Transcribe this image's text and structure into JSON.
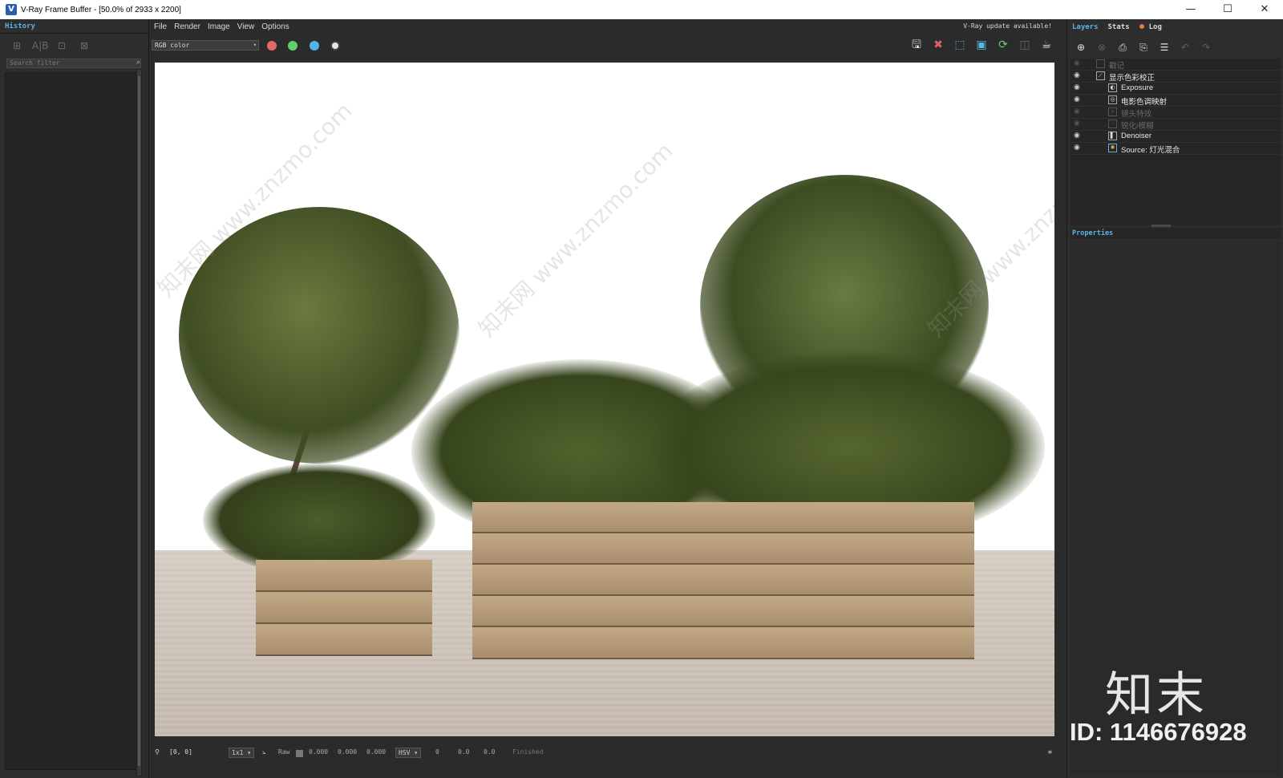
{
  "window": {
    "title": "V-Ray Frame Buffer - [50.0% of 2933 x 2200]",
    "minimize": "—",
    "maximize": "☐",
    "close": "✕"
  },
  "history": {
    "tab_label": "History",
    "search_placeholder": "Search filter"
  },
  "menu": {
    "items": [
      "File",
      "Render",
      "Image",
      "View",
      "Options"
    ],
    "update_note": "V-Ray update available!"
  },
  "toolbar": {
    "channel": "RGB color",
    "dots": {
      "red": "#e36a6a",
      "green": "#5fcf6a",
      "blue": "#52b5ea"
    }
  },
  "status": {
    "coords": "[0, 0]",
    "zoom": "1x1",
    "raw_label": "Raw",
    "v1": "0.000",
    "v2": "0.000",
    "v3": "0.000",
    "mode": "HSV",
    "h": "0",
    "s": "0.0",
    "v": "0.0",
    "state": "Finished"
  },
  "right_panel": {
    "tabs": [
      "Layers",
      "Stats",
      "Log"
    ],
    "layers": [
      {
        "name": "戳记",
        "visible": false,
        "indent": 1
      },
      {
        "name": "显示色彩校正",
        "visible": true,
        "indent": 1
      },
      {
        "name": "Exposure",
        "visible": true,
        "indent": 2
      },
      {
        "name": "电影色调映射",
        "visible": true,
        "indent": 2
      },
      {
        "name": "镜头特效",
        "visible": false,
        "indent": 2
      },
      {
        "name": "锐化/模糊",
        "visible": false,
        "indent": 2
      },
      {
        "name": "Denoiser",
        "visible": true,
        "indent": 2
      },
      {
        "name": "Source: 灯光混合",
        "visible": true,
        "indent": 2
      }
    ],
    "properties_label": "Properties"
  },
  "watermark": {
    "text": "知末网 www.znzmo.com",
    "logo": "知末",
    "id": "ID: 1146676928"
  }
}
